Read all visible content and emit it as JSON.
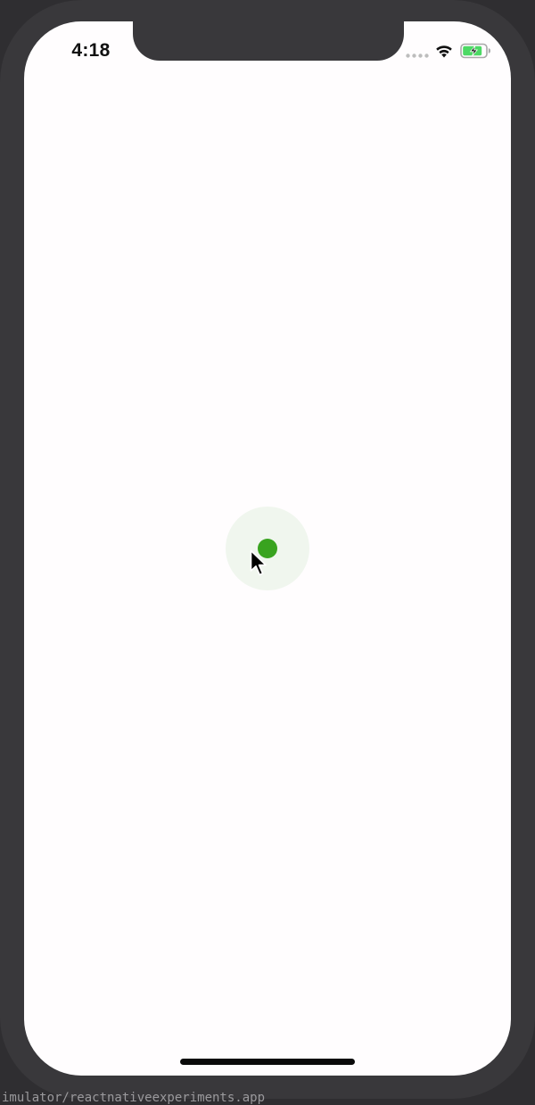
{
  "status_bar": {
    "time": "4:18",
    "icons": [
      "signal-dots-icon",
      "wifi-icon",
      "battery-charging-icon"
    ],
    "battery_color": "#4cd964"
  },
  "touch_indicator": {
    "dot_color": "#39a31f",
    "halo_color": "#f0f6ee"
  },
  "cursor": {
    "icon": "arrow-cursor-icon"
  },
  "bottom_console": {
    "text": "imulator/reactnativeexperiments.app"
  },
  "colors": {
    "device_frame": "#39383b",
    "screen_background": "#fffdfe",
    "outer_background": "#2f2e31"
  }
}
